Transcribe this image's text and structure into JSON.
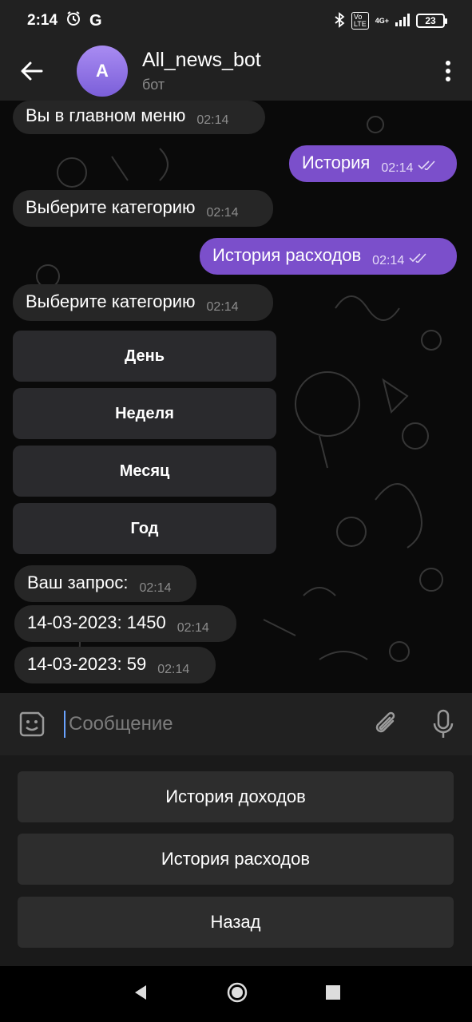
{
  "status": {
    "time": "2:14",
    "network": "4G+",
    "battery": "23"
  },
  "header": {
    "avatar_letter": "A",
    "title": "All_news_bot",
    "subtitle": "бот"
  },
  "messages": [
    {
      "text": "Вы в главном меню",
      "time": "02:14",
      "dir": "in"
    },
    {
      "text": "История",
      "time": "02:14",
      "dir": "out"
    },
    {
      "text": "Выберите категорию",
      "time": "02:14",
      "dir": "in"
    },
    {
      "text": "История расходов",
      "time": "02:14",
      "dir": "out"
    },
    {
      "text": "Выберите категорию",
      "time": "02:14",
      "dir": "in"
    },
    {
      "text": "Ваш запрос:",
      "time": "02:14",
      "dir": "in"
    },
    {
      "text": "14-03-2023: 1450",
      "time": "02:14",
      "dir": "in"
    },
    {
      "text": "14-03-2023: 59",
      "time": "02:14",
      "dir": "in"
    }
  ],
  "inline_keyboard": [
    "День",
    "Неделя",
    "Месяц",
    "Год"
  ],
  "composer": {
    "placeholder": "Сообщение"
  },
  "reply_keyboard": [
    "История доходов",
    "История расходов",
    "Назад"
  ],
  "colors": {
    "accent": "#7b4fcb",
    "bar": "#212121",
    "bubble_in": "#262626"
  }
}
